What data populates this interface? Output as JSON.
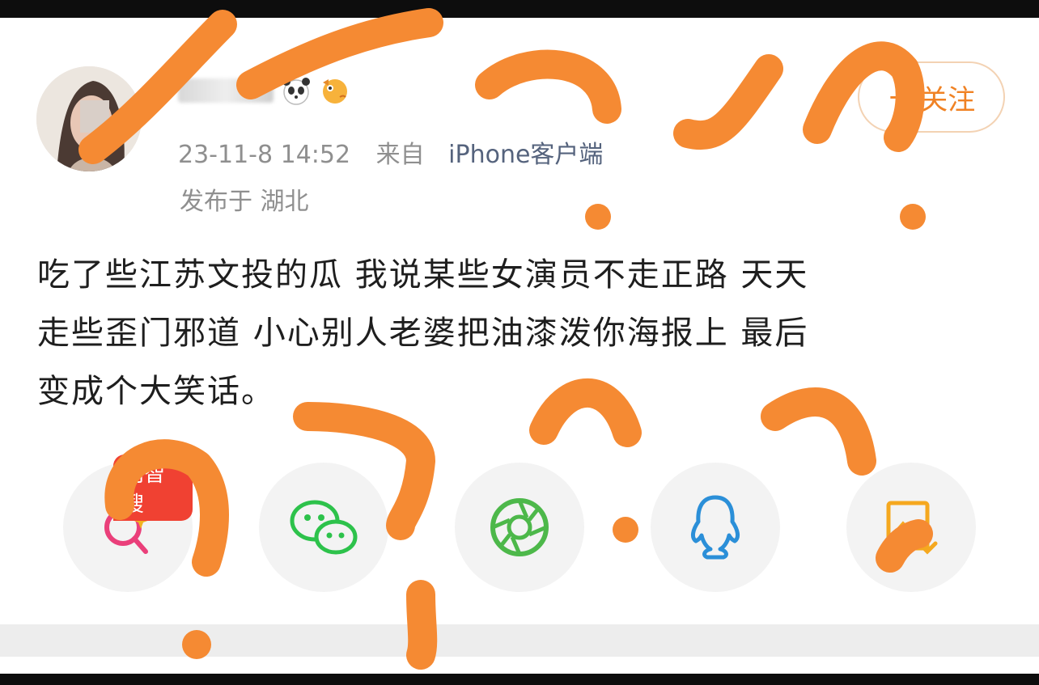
{
  "post": {
    "meta_line": {
      "time": "23-11-8 14:52",
      "from_label": "来自",
      "source": "iPhone客户端"
    },
    "location": "发布于 湖北",
    "follow_label": "关注",
    "follow_plus": "+",
    "content_lines": [
      "吃了些江苏文投的瓜 我说某些女演员不走正路 天天",
      "走些歪门邪道 小心别人老婆把油漆泼你海报上 最后",
      "变成个大笑话。"
    ]
  },
  "share": {
    "ai_search_badge": "问智搜",
    "items": [
      {
        "icon": "ai-search-icon"
      },
      {
        "icon": "wechat-icon"
      },
      {
        "icon": "moments-shutter-icon"
      },
      {
        "icon": "qq-icon"
      },
      {
        "icon": "save-image-icon"
      }
    ]
  },
  "colors": {
    "scribble": "#f58a33",
    "follow": "#f08224",
    "meta_gray": "#8f8f8f",
    "source_blue": "#55637d",
    "wechat": "#2dc24b",
    "moments": "#4db84a",
    "qq": "#2b8fd8",
    "ai_search": "#ea3f7a"
  }
}
